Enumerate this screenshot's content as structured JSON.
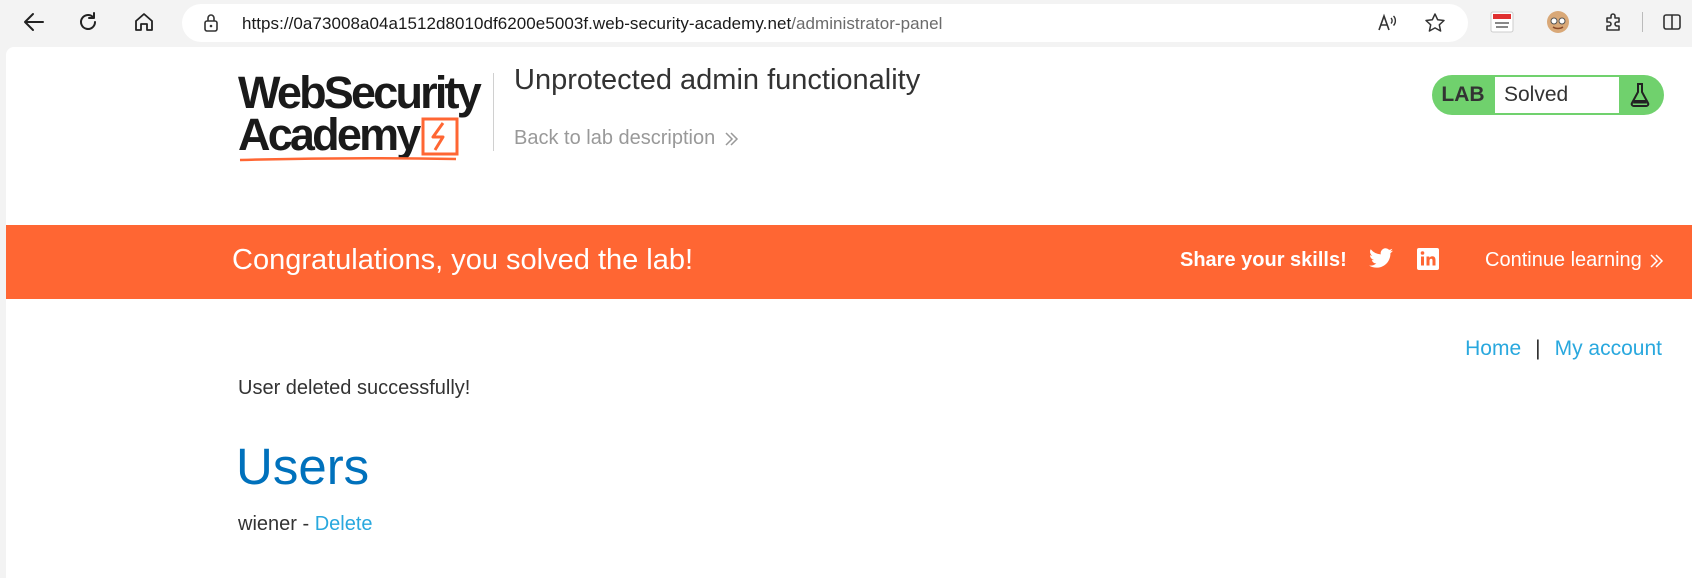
{
  "browser": {
    "url_host": "https://0a73008a04a1512d8010df6200e5003f.web-security-academy.net",
    "url_path": "/administrator-panel"
  },
  "header": {
    "logo_line1": "WebSecurity",
    "logo_line2": "Academy",
    "lab_title": "Unprotected admin functionality",
    "back_link": "Back to lab description",
    "lab_label": "LAB",
    "lab_status": "Solved"
  },
  "banner": {
    "congrats": "Congratulations, you solved the lab!",
    "share": "Share your skills!",
    "continue": "Continue learning"
  },
  "nav": {
    "home": "Home",
    "separator": "|",
    "account": "My account"
  },
  "main": {
    "message": "User deleted successfully!",
    "heading": "Users",
    "users": [
      {
        "name": "wiener",
        "dash": "-",
        "action": "Delete"
      }
    ]
  },
  "colors": {
    "accent_orange": "#ff6633",
    "badge_green": "#70d16d",
    "link_blue": "#29a8de",
    "heading_blue": "#0071bc"
  }
}
